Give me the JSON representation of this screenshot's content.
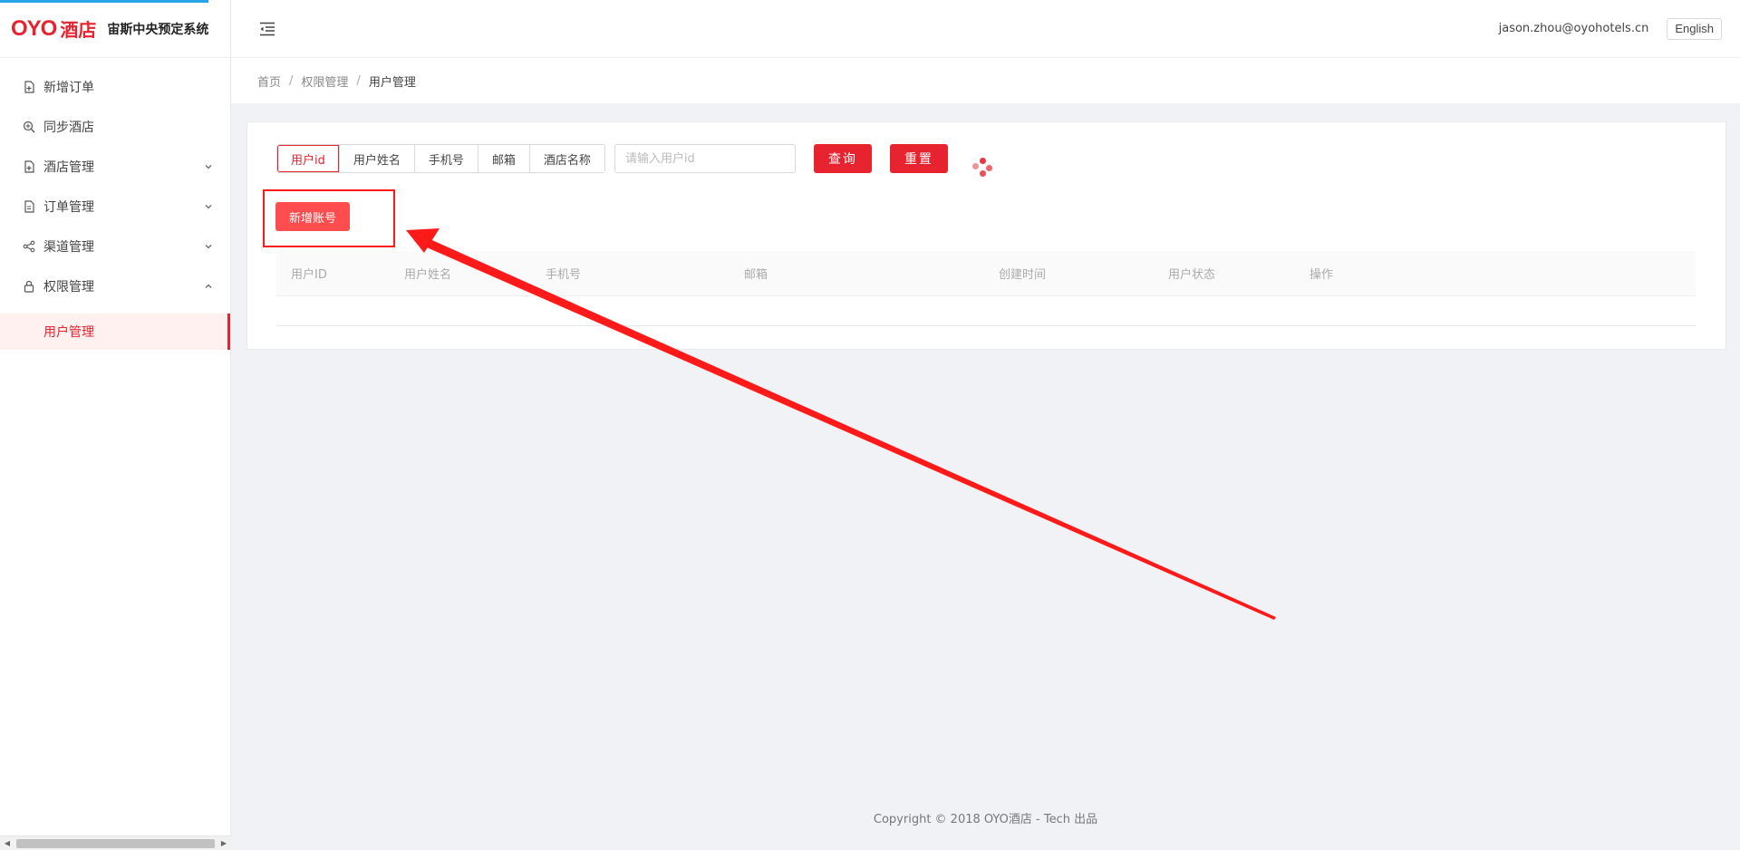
{
  "brand": {
    "logo_text": "OYO",
    "logo_cn": "酒店",
    "system_title": "宙斯中央预定系统"
  },
  "sidebar": {
    "items": [
      {
        "label": "新增订单",
        "icon": "file-add-icon"
      },
      {
        "label": "同步酒店",
        "icon": "sync-search-icon"
      },
      {
        "label": "酒店管理",
        "icon": "file-icon",
        "expandable": true
      },
      {
        "label": "订单管理",
        "icon": "file-text-icon",
        "expandable": true
      },
      {
        "label": "渠道管理",
        "icon": "share-icon",
        "expandable": true
      },
      {
        "label": "权限管理",
        "icon": "lock-icon",
        "expanded": true
      }
    ],
    "sub_item": "用户管理"
  },
  "header": {
    "user_email": "jason.zhou@oyohotels.cn",
    "language_button": "English"
  },
  "breadcrumb": [
    "首页",
    "权限管理",
    "用户管理"
  ],
  "filter": {
    "segments": [
      "用户id",
      "用户姓名",
      "手机号",
      "邮箱",
      "酒店名称"
    ],
    "active_segment": "用户id",
    "search_placeholder": "请输入用户id",
    "search_value": "",
    "query_button": "查询",
    "reset_button": "重置"
  },
  "add_button": "新增账号",
  "table": {
    "columns": [
      "用户ID",
      "用户姓名",
      "手机号",
      "邮箱",
      "创建时间",
      "用户状态",
      "操作"
    ],
    "rows": []
  },
  "footer": {
    "text": "Copyright © 2018 OYO酒店 - Tech 出品"
  },
  "colors": {
    "accent": "#e6232f",
    "annotation": "#ff1a1a"
  }
}
